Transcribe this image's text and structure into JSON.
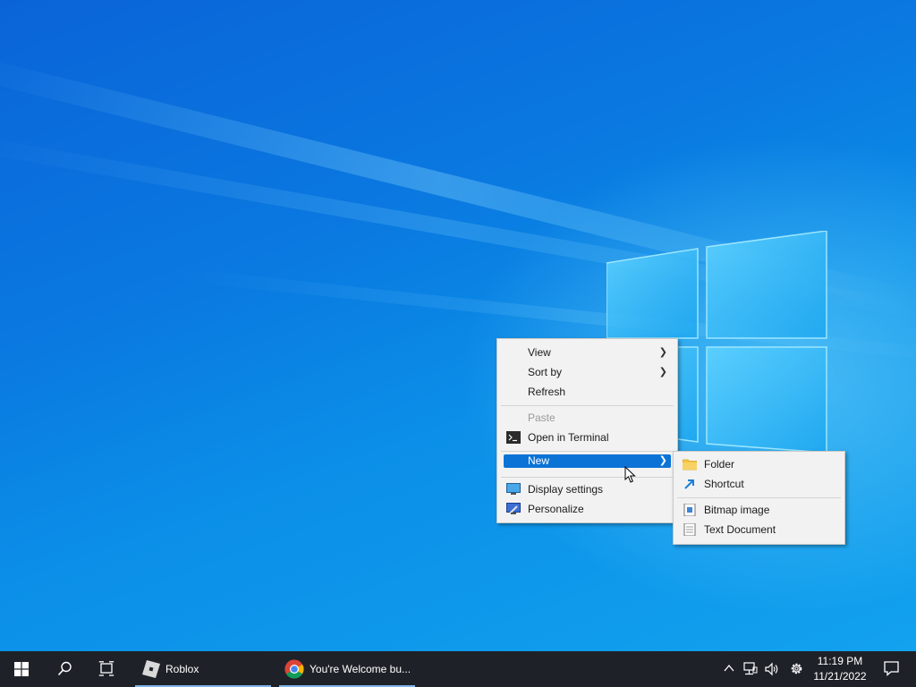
{
  "context_menu": {
    "items": [
      {
        "label": "View",
        "has_submenu": true
      },
      {
        "label": "Sort by",
        "has_submenu": true
      },
      {
        "label": "Refresh"
      },
      {
        "label": "Paste",
        "disabled": true
      },
      {
        "label": "Open in Terminal",
        "icon": "terminal-icon"
      },
      {
        "label": "New",
        "has_submenu": true,
        "highlighted": true
      },
      {
        "label": "Display settings",
        "icon": "display-icon"
      },
      {
        "label": "Personalize",
        "icon": "personalize-icon"
      }
    ]
  },
  "new_submenu": {
    "items": [
      {
        "label": "Folder",
        "icon": "folder-icon"
      },
      {
        "label": "Shortcut",
        "icon": "shortcut-icon"
      },
      {
        "label": "Bitmap image",
        "icon": "bitmap-icon"
      },
      {
        "label": "Text Document",
        "icon": "text-document-icon"
      }
    ]
  },
  "taskbar": {
    "apps": [
      {
        "label": "Roblox",
        "icon": "roblox-icon"
      },
      {
        "label": "You're Welcome bu...",
        "icon": "chrome-icon"
      }
    ],
    "clock": {
      "time": "11:19 PM",
      "date": "11/21/2022"
    }
  },
  "colors": {
    "highlight": "#0b73d6",
    "taskbar": "#1e2228",
    "desktop_blue": "#0a78e0"
  }
}
